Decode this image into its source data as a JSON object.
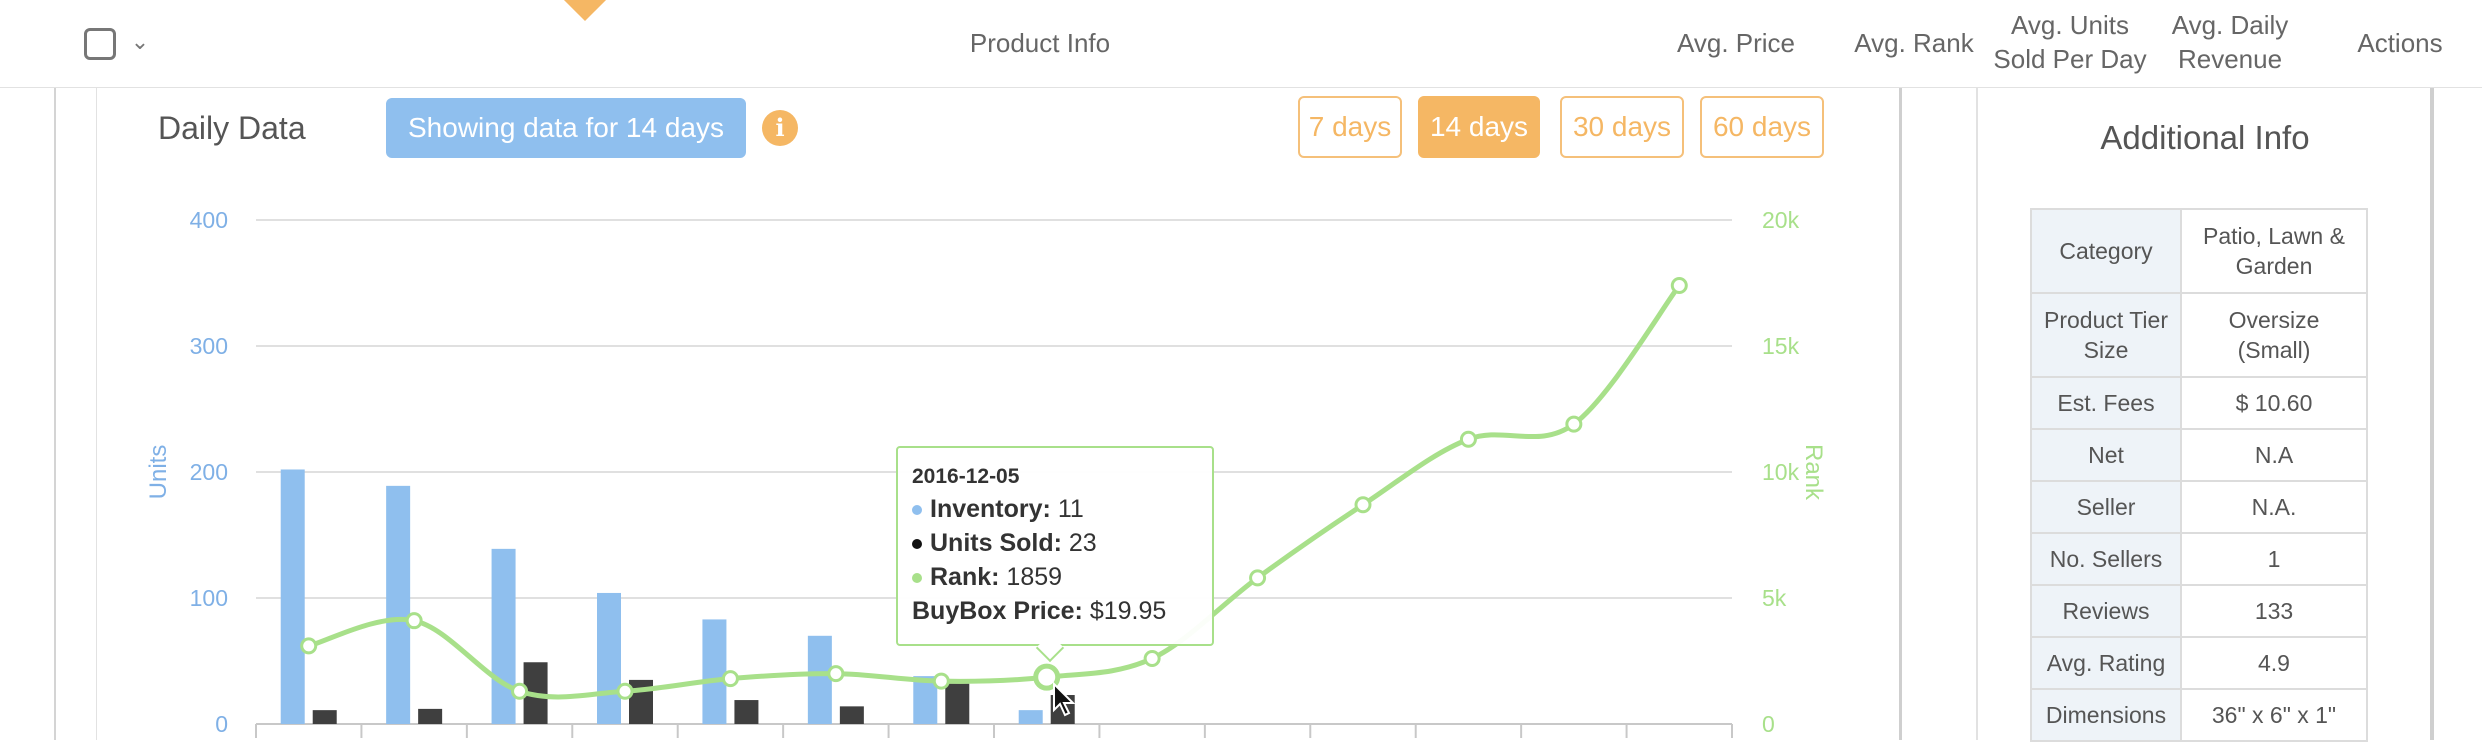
{
  "header": {
    "product_info": "Product Info",
    "avg_price": "Avg. Price",
    "avg_rank": "Avg. Rank",
    "avg_units_line1": "Avg. Units",
    "avg_units_line2": "Sold Per Day",
    "avg_daily_line1": "Avg. Daily",
    "avg_daily_line2": "Revenue",
    "actions": "Actions",
    "chevron_icon": "chevron-down-icon"
  },
  "daily": {
    "title": "Daily Data",
    "badge": "Showing data for 14 days",
    "info_icon": "i",
    "ranges": [
      {
        "label": "7 days",
        "active": false
      },
      {
        "label": "14 days",
        "active": true
      },
      {
        "label": "30 days",
        "active": false
      },
      {
        "label": "60 days",
        "active": false
      }
    ]
  },
  "colors": {
    "inventory": "#8fbfee",
    "units_sold": "#3f3f3f",
    "rank": "#a8e08a",
    "accent_orange": "#f5b764"
  },
  "chart_data": {
    "type": "bar",
    "left_axis": {
      "title": "Units",
      "ticks": [
        "0",
        "100",
        "200",
        "300",
        "400"
      ],
      "ylim": [
        0,
        400
      ]
    },
    "right_axis": {
      "title": "Rank",
      "ticks": [
        "0",
        "5k",
        "10k",
        "15k",
        "20k"
      ],
      "ylim": [
        0,
        20000
      ]
    },
    "grid": true,
    "series": [
      {
        "name": "Inventory",
        "kind": "bar",
        "axis": "left",
        "values": [
          202,
          189,
          139,
          104,
          83,
          70,
          38,
          11,
          null,
          null,
          null,
          null,
          null,
          null
        ]
      },
      {
        "name": "Units Sold",
        "kind": "bar",
        "axis": "left",
        "values": [
          11,
          12,
          49,
          35,
          19,
          14,
          32,
          23,
          null,
          null,
          null,
          null,
          null,
          null
        ]
      },
      {
        "name": "Rank",
        "kind": "line",
        "axis": "right",
        "values": [
          3100,
          4100,
          1300,
          1300,
          1800,
          2000,
          1700,
          1859,
          2600,
          5800,
          8700,
          11300,
          11900,
          17400
        ]
      }
    ]
  },
  "tooltip": {
    "date": "2016-12-05",
    "inventory_label": "Inventory:",
    "inventory_value": "11",
    "units_label": "Units Sold:",
    "units_value": "23",
    "rank_label": "Rank:",
    "rank_value": "1859",
    "buybox_label": "BuyBox Price:",
    "buybox_value": "$19.95"
  },
  "info": {
    "title": "Additional Info",
    "rows": [
      {
        "key": "Category",
        "value": "Patio, Lawn & Garden"
      },
      {
        "key": "Product Tier Size",
        "value": "Oversize (Small)"
      },
      {
        "key": "Est. Fees",
        "value": "$ 10.60"
      },
      {
        "key": "Net",
        "value": "N.A"
      },
      {
        "key": "Seller",
        "value": "N.A."
      },
      {
        "key": "No. Sellers",
        "value": "1"
      },
      {
        "key": "Reviews",
        "value": "133"
      },
      {
        "key": "Avg. Rating",
        "value": "4.9"
      },
      {
        "key": "Dimensions",
        "value": "36\" x 6\" x 1\""
      }
    ]
  }
}
